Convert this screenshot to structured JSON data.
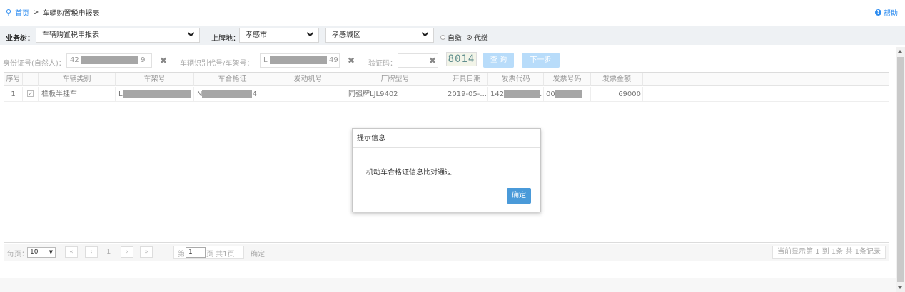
{
  "breadcrumb": {
    "home": "首页",
    "separator": ">",
    "current": "车辆购置税申报表",
    "icon": "map-pin-icon"
  },
  "help": {
    "label": "帮助",
    "icon": "question-circle-icon"
  },
  "filters": {
    "business_tree_label": "业务树：",
    "business_tree_value": "车辆购置税申报表",
    "register_place_label": "上牌地：",
    "city_value": "孝感市",
    "district_value": "孝感城区",
    "radio_self": "自缴",
    "radio_agent": "代缴",
    "selected_radio": "代缴"
  },
  "search": {
    "id_label": "身份证号(自然人)：",
    "id_prefix": "42",
    "id_suffix": "9",
    "vin_label": "车辆识别代号/车架号：",
    "vin_prefix": "L",
    "vin_suffix": "49",
    "captcha_label": "验证码：",
    "captcha_input": "",
    "captcha_image": "8014",
    "query_button": "查 询",
    "next_button": "下一步"
  },
  "table": {
    "columns": [
      "序号",
      "车辆类别",
      "车架号",
      "车合格证",
      "发动机号",
      "厂牌型号",
      "开具日期",
      "发票代码",
      "发票号码",
      "发票金额"
    ],
    "rows": [
      {
        "index": "1",
        "checked": true,
        "vehicle_type": "栏板半挂车",
        "frame_no_prefix": "L",
        "cert_prefix": "N",
        "cert_suffix": "4",
        "engine_no": "",
        "brand_model": "同强牌LJL9402",
        "issue_date": "2019-05-...",
        "invoice_code_prefix": "142",
        "invoice_code_suffix": ".",
        "invoice_no_prefix": "00",
        "amount": "69000"
      }
    ]
  },
  "pager": {
    "per_page_label": "每页：",
    "per_page_value": "10",
    "page_number": "1",
    "page_label_prefix": "第",
    "page_input": "1",
    "page_label_suffix": "页 共1页",
    "confirm": "确定",
    "summary": "当前显示第  1 到  1条  共  1条记录"
  },
  "dialog": {
    "title": "提示信息",
    "message": "机动车合格证信息比对通过",
    "ok_button": "确定"
  },
  "colors": {
    "accent": "#2d8cf0",
    "dialog_button": "#4a9ad9",
    "disabled_button": "#b8dcfa",
    "filter_bg": "#eef1f4"
  }
}
